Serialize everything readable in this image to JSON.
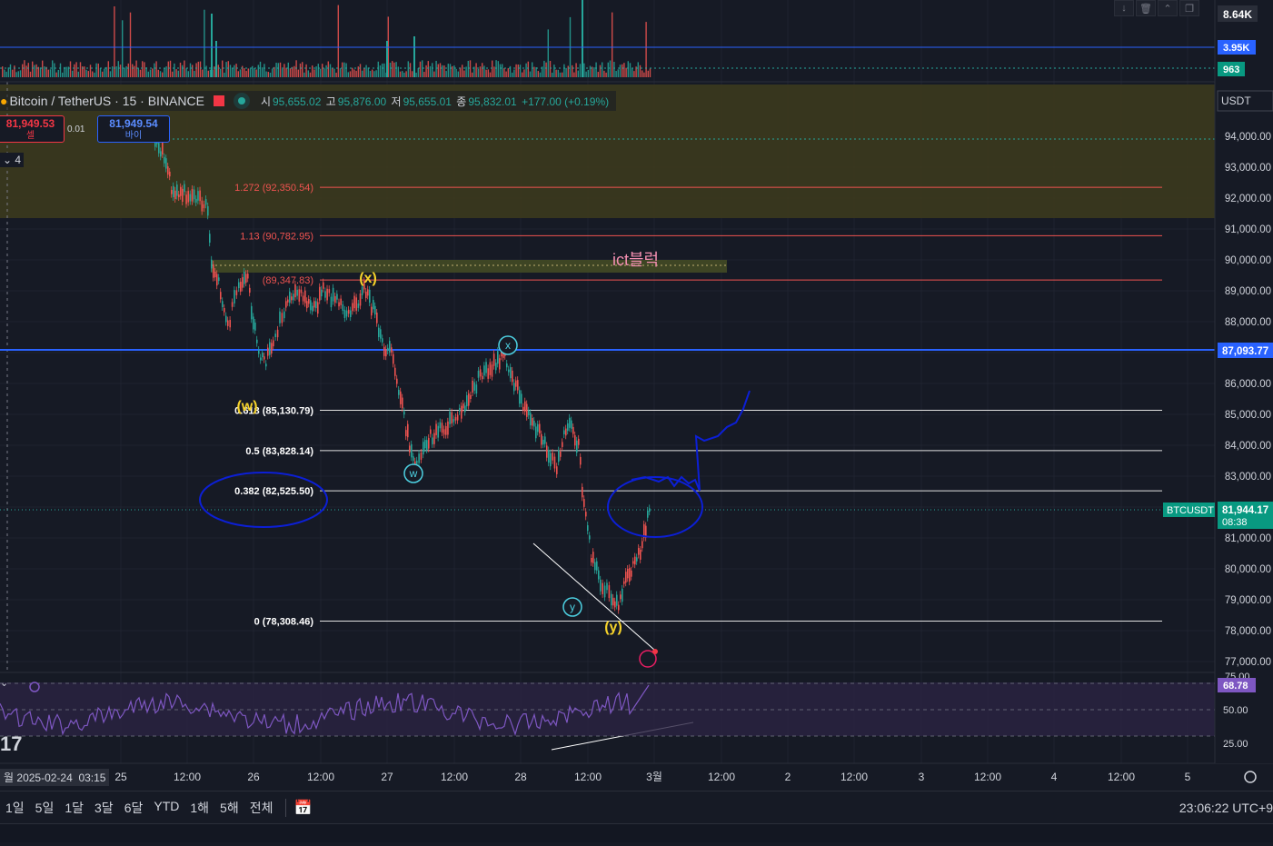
{
  "symbol": {
    "name": "Bitcoin / TetherUS · 15 · BINANCE",
    "open_label": "시",
    "open": "95,655.02",
    "high_label": "고",
    "high": "95,876.00",
    "low_label": "저",
    "low": "95,655.01",
    "close_label": "종",
    "close": "95,832.01",
    "change": "+177.00 (+0.19%)"
  },
  "order": {
    "sell_price": "81,949.53",
    "sell_label": "셀",
    "buy_price": "81,949.54",
    "buy_label": "바이",
    "spread": "0.01"
  },
  "collapse_label": "4",
  "currency": "USDT",
  "volume_labels": {
    "top": "8.64K",
    "ma": "3.95K",
    "current": "963"
  },
  "price_axis": [
    "94,000.00",
    "93,000.00",
    "92,000.00",
    "91,000.00",
    "90,000.00",
    "89,000.00",
    "88,000.00",
    "86,000.00",
    "85,000.00",
    "84,000.00",
    "83,000.00",
    "81,000.00",
    "80,000.00",
    "79,000.00",
    "78,000.00",
    "77,000.00"
  ],
  "price_tags": {
    "blue_line": "87,093.77",
    "last_price": "81,944.17",
    "countdown": "08:38",
    "ticker": "BTCUSDT"
  },
  "fib_levels": [
    {
      "label": "1.272 (92,350.54)",
      "price": 92350.54
    },
    {
      "label": "1.13 (90,782.95)",
      "price": 90782.95
    },
    {
      "label": "(89,347.83)",
      "price": 89347.83
    },
    {
      "label": "0.618 (85,130.79)",
      "price": 85130.79
    },
    {
      "label": "0.5 (83,828.14)",
      "price": 83828.14
    },
    {
      "label": "0.382 (82,525.50)",
      "price": 82525.5
    },
    {
      "label": "0 (78,308.46)",
      "price": 78308.46
    }
  ],
  "annotations": {
    "ict_block": "ict블럭",
    "wave_w_yellow": "(w)",
    "wave_x_yellow": "(x)",
    "wave_y_yellow": "(y)",
    "wave_x_circle": "x",
    "wave_w_circle": "w",
    "wave_y_circle": "y"
  },
  "rsi": {
    "value": "68.78",
    "levels": [
      "75.00",
      "50.00",
      "25.00"
    ]
  },
  "time_axis": {
    "current_date": "2025-02-24",
    "current_time": "03:15",
    "prefix": "월",
    "labels": [
      "25",
      "12:00",
      "26",
      "12:00",
      "27",
      "12:00",
      "28",
      "12:00",
      "3월",
      "12:00",
      "2",
      "12:00",
      "3",
      "12:00",
      "4",
      "12:00",
      "5"
    ]
  },
  "toolbar": {
    "timeframes": [
      "1일",
      "5일",
      "1달",
      "3달",
      "6달",
      "YTD",
      "1해",
      "5해",
      "전체"
    ],
    "clock": "23:06:22 UTC+9"
  },
  "colors": {
    "background": "#161a25",
    "up": "#26a69a",
    "down": "#ef5350",
    "blue_line": "#2962ff",
    "rsi": "#7e57c2",
    "drawing": "#0c1fd6"
  }
}
